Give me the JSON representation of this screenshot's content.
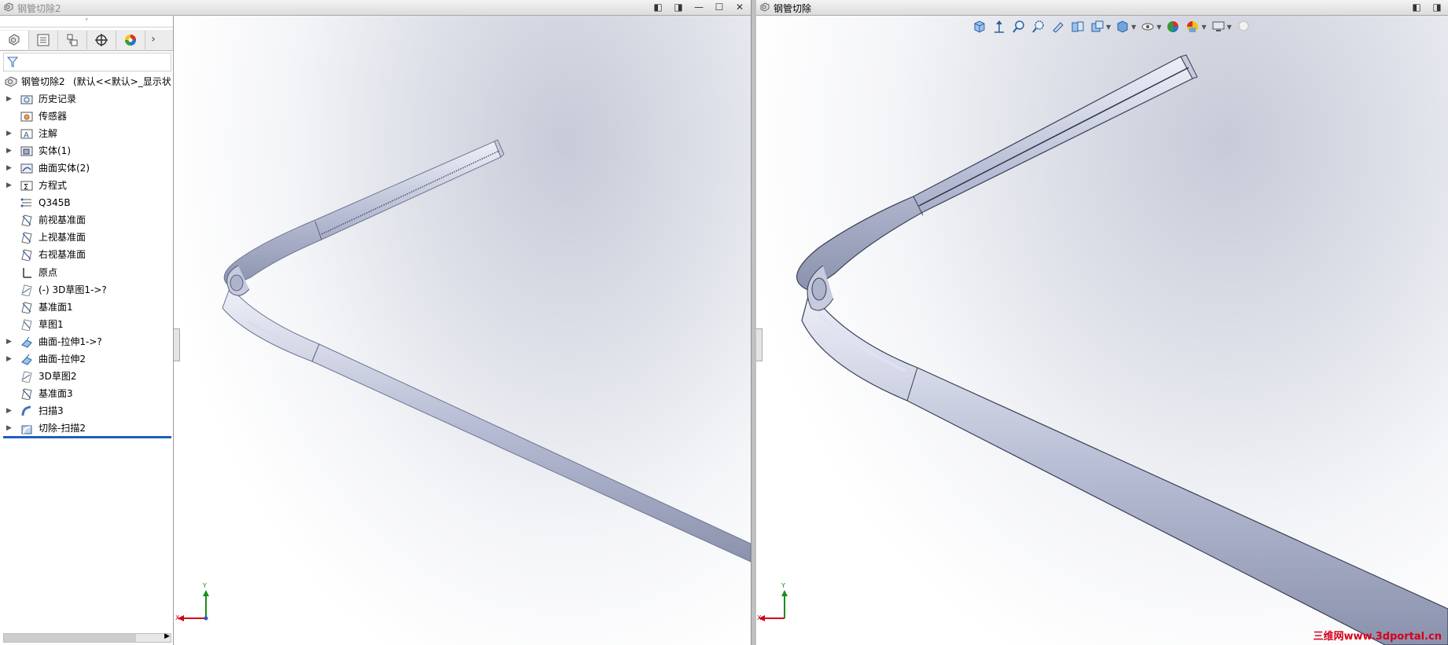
{
  "left_window": {
    "title": "钢管切除2",
    "tree_root": "钢管切除2",
    "tree_root_suffix": "(默认<<默认>_显示状态",
    "tree_items": [
      {
        "label": "历史记录",
        "expandable": true,
        "icon": "history-folder-icon"
      },
      {
        "label": "传感器",
        "expandable": false,
        "icon": "sensor-icon"
      },
      {
        "label": "注解",
        "expandable": true,
        "icon": "annotation-icon"
      },
      {
        "label": "实体(1)",
        "expandable": true,
        "icon": "solid-bodies-icon"
      },
      {
        "label": "曲面实体(2)",
        "expandable": true,
        "icon": "surface-bodies-icon"
      },
      {
        "label": "方程式",
        "expandable": true,
        "icon": "equations-icon"
      },
      {
        "label": "Q345B",
        "expandable": false,
        "icon": "material-icon"
      },
      {
        "label": "前视基准面",
        "expandable": false,
        "icon": "plane-icon"
      },
      {
        "label": "上视基准面",
        "expandable": false,
        "icon": "plane-icon"
      },
      {
        "label": "右视基准面",
        "expandable": false,
        "icon": "plane-icon"
      },
      {
        "label": "原点",
        "expandable": false,
        "icon": "origin-icon"
      },
      {
        "label": "(-) 3D草图1->?",
        "expandable": false,
        "icon": "sketch3d-icon"
      },
      {
        "label": "基准面1",
        "expandable": false,
        "icon": "plane-icon"
      },
      {
        "label": "草图1",
        "expandable": false,
        "icon": "sketch-icon"
      },
      {
        "label": "曲面-拉伸1->?",
        "expandable": true,
        "icon": "surface-extrude-icon"
      },
      {
        "label": "曲面-拉伸2",
        "expandable": true,
        "icon": "surface-extrude-icon"
      },
      {
        "label": "3D草图2",
        "expandable": false,
        "icon": "sketch3d-icon"
      },
      {
        "label": "基准面3",
        "expandable": false,
        "icon": "plane-icon"
      },
      {
        "label": "扫描3",
        "expandable": true,
        "icon": "sweep-icon"
      },
      {
        "label": "切除-扫描2",
        "expandable": true,
        "icon": "cut-sweep-icon"
      }
    ],
    "triad": {
      "x": "X",
      "y": "Y"
    }
  },
  "right_window": {
    "title": "钢管切除",
    "triad": {
      "x": "X",
      "y": "Y"
    }
  },
  "watermark": "三维网www.3dportal.cn",
  "colors": {
    "accent_blue": "#1f5fbf",
    "pipe": "#b9bfd6",
    "x_axis": "#d0021b",
    "y_axis": "#1a8f1a",
    "watermark": "#d6001c"
  }
}
